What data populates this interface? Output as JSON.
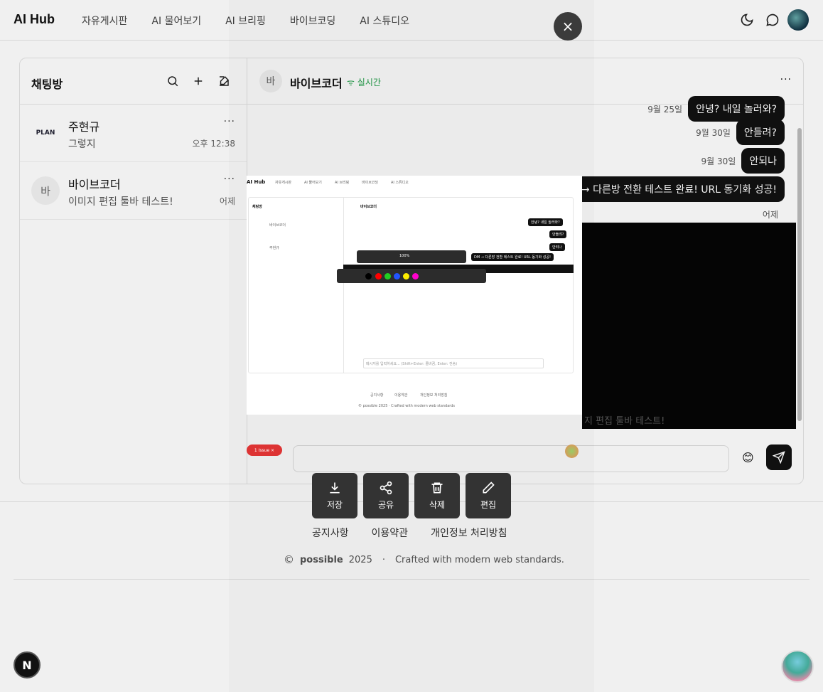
{
  "header": {
    "logo": "AI Hub",
    "nav": [
      "자유게시판",
      "AI 물어보기",
      "AI 브리핑",
      "바이브코딩",
      "AI 스튜디오"
    ]
  },
  "sidebar": {
    "title": "채팅방",
    "rooms": [
      {
        "avatar": "PLAN",
        "name": "주현규",
        "message": "그렇지",
        "time": "오후 12:38",
        "more": "···"
      },
      {
        "avatar": "바",
        "name": "바이브코더",
        "message": "이미지 편집 툴바 테스트!",
        "time": "어제",
        "more": "···"
      }
    ]
  },
  "chat": {
    "avatar": "바",
    "name": "바이브코더",
    "status": "실시간",
    "more": "···",
    "messages": [
      {
        "time": "9월 25일",
        "text": "안녕? 내일 놀러와?"
      },
      {
        "time": "9월 30일",
        "text": "안들려?"
      },
      {
        "time": "9월 30일",
        "text": "안되나"
      },
      {
        "time": "",
        "text": "→ 다른방 전환 테스트 완료! URL 동기화 성공!"
      }
    ],
    "date_label": "어제",
    "partial_text": "지 편집 툴바 테스트!",
    "emoji": "😊"
  },
  "viewer": {
    "close": "×",
    "actions": [
      {
        "icon": "download-icon",
        "label": "저장"
      },
      {
        "icon": "share-icon",
        "label": "공유"
      },
      {
        "icon": "trash-icon",
        "label": "삭제"
      },
      {
        "icon": "pencil-icon",
        "label": "편집"
      }
    ],
    "issue_pill": "1 Issue ×"
  },
  "preview": {
    "logo": "AI Hub",
    "nav": [
      "자유게시판",
      "AI 물어보기",
      "AI 브리핑",
      "바이브코딩",
      "AI 스튜디오"
    ],
    "sidebar_title": "채팅방",
    "rooms": [
      "바이브코더",
      "주현규"
    ],
    "chat_name": "바이브코더",
    "bubbles": [
      "안녕? 내일 놀러와?",
      "안들려?",
      "안되나",
      "DM → 다른방 전환 테스트 완료! URL 동기화 성공!"
    ],
    "zoom": "100%",
    "input_placeholder": "메시지를 입력하세요... (Shift+Enter: 줄바꿈, Enter: 전송)",
    "footer_links": [
      "공지사항",
      "이용약관",
      "개인정보 처리방침"
    ],
    "footer_copy": "© possible 2025 · Crafted with modern web standards",
    "colors": [
      "#000000",
      "#ff0000",
      "#22cc22",
      "#2255ff",
      "#ffee00",
      "#ff00cc"
    ]
  },
  "footer": {
    "links": [
      "공지사항",
      "이용약관",
      "개인정보 처리방침"
    ],
    "copy_symbol": "©",
    "brand": "possible",
    "year": "2025",
    "sep": "·",
    "tagline": "Crafted with modern web standards."
  },
  "badges": {
    "next": "N"
  }
}
